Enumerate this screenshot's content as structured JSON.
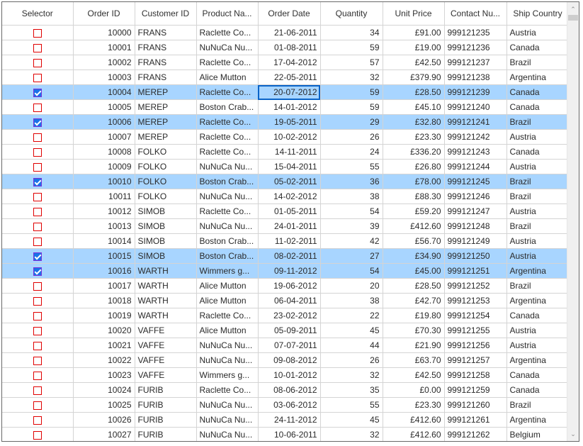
{
  "columns": [
    "Selector",
    "Order ID",
    "Customer ID",
    "Product Na...",
    "Order Date",
    "Quantity",
    "Unit Price",
    "Contact Nu...",
    "Ship Country"
  ],
  "rows": [
    {
      "checked": false,
      "order_id": "10000",
      "customer_id": "FRANS",
      "product": "Raclette Co...",
      "date": "21-06-2011",
      "qty": "34",
      "price": "£91.00",
      "contact": "999121235",
      "country": "Austria"
    },
    {
      "checked": false,
      "order_id": "10001",
      "customer_id": "FRANS",
      "product": "NuNuCa Nu...",
      "date": "01-08-2011",
      "qty": "59",
      "price": "£19.00",
      "contact": "999121236",
      "country": "Canada"
    },
    {
      "checked": false,
      "order_id": "10002",
      "customer_id": "FRANS",
      "product": "Raclette Co...",
      "date": "17-04-2012",
      "qty": "57",
      "price": "£42.50",
      "contact": "999121237",
      "country": "Brazil"
    },
    {
      "checked": false,
      "order_id": "10003",
      "customer_id": "FRANS",
      "product": "Alice Mutton",
      "date": "22-05-2011",
      "qty": "32",
      "price": "£379.90",
      "contact": "999121238",
      "country": "Argentina"
    },
    {
      "checked": true,
      "order_id": "10004",
      "customer_id": "MEREP",
      "product": "Raclette Co...",
      "date": "20-07-2012",
      "qty": "59",
      "price": "£28.50",
      "contact": "999121239",
      "country": "Canada",
      "focus": true
    },
    {
      "checked": false,
      "order_id": "10005",
      "customer_id": "MEREP",
      "product": "Boston Crab...",
      "date": "14-01-2012",
      "qty": "59",
      "price": "£45.10",
      "contact": "999121240",
      "country": "Canada"
    },
    {
      "checked": true,
      "order_id": "10006",
      "customer_id": "MEREP",
      "product": "Raclette Co...",
      "date": "19-05-2011",
      "qty": "29",
      "price": "£32.80",
      "contact": "999121241",
      "country": "Brazil"
    },
    {
      "checked": false,
      "order_id": "10007",
      "customer_id": "MEREP",
      "product": "Raclette Co...",
      "date": "10-02-2012",
      "qty": "26",
      "price": "£23.30",
      "contact": "999121242",
      "country": "Austria"
    },
    {
      "checked": false,
      "order_id": "10008",
      "customer_id": "FOLKO",
      "product": "Raclette Co...",
      "date": "14-11-2011",
      "qty": "24",
      "price": "£336.20",
      "contact": "999121243",
      "country": "Canada"
    },
    {
      "checked": false,
      "order_id": "10009",
      "customer_id": "FOLKO",
      "product": "NuNuCa Nu...",
      "date": "15-04-2011",
      "qty": "55",
      "price": "£26.80",
      "contact": "999121244",
      "country": "Austria"
    },
    {
      "checked": true,
      "order_id": "10010",
      "customer_id": "FOLKO",
      "product": "Boston Crab...",
      "date": "05-02-2011",
      "qty": "36",
      "price": "£78.00",
      "contact": "999121245",
      "country": "Brazil"
    },
    {
      "checked": false,
      "order_id": "10011",
      "customer_id": "FOLKO",
      "product": "NuNuCa Nu...",
      "date": "14-02-2012",
      "qty": "38",
      "price": "£88.30",
      "contact": "999121246",
      "country": "Brazil"
    },
    {
      "checked": false,
      "order_id": "10012",
      "customer_id": "SIMOB",
      "product": "Raclette Co...",
      "date": "01-05-2011",
      "qty": "54",
      "price": "£59.20",
      "contact": "999121247",
      "country": "Austria"
    },
    {
      "checked": false,
      "order_id": "10013",
      "customer_id": "SIMOB",
      "product": "NuNuCa Nu...",
      "date": "24-01-2011",
      "qty": "39",
      "price": "£412.60",
      "contact": "999121248",
      "country": "Brazil"
    },
    {
      "checked": false,
      "order_id": "10014",
      "customer_id": "SIMOB",
      "product": "Boston Crab...",
      "date": "11-02-2011",
      "qty": "42",
      "price": "£56.70",
      "contact": "999121249",
      "country": "Austria"
    },
    {
      "checked": true,
      "order_id": "10015",
      "customer_id": "SIMOB",
      "product": "Boston Crab...",
      "date": "08-02-2011",
      "qty": "27",
      "price": "£34.90",
      "contact": "999121250",
      "country": "Austria"
    },
    {
      "checked": true,
      "order_id": "10016",
      "customer_id": "WARTH",
      "product": "Wimmers g...",
      "date": "09-11-2012",
      "qty": "54",
      "price": "£45.00",
      "contact": "999121251",
      "country": "Argentina"
    },
    {
      "checked": false,
      "order_id": "10017",
      "customer_id": "WARTH",
      "product": "Alice Mutton",
      "date": "19-06-2012",
      "qty": "20",
      "price": "£28.50",
      "contact": "999121252",
      "country": "Brazil"
    },
    {
      "checked": false,
      "order_id": "10018",
      "customer_id": "WARTH",
      "product": "Alice Mutton",
      "date": "06-04-2011",
      "qty": "38",
      "price": "£42.70",
      "contact": "999121253",
      "country": "Argentina"
    },
    {
      "checked": false,
      "order_id": "10019",
      "customer_id": "WARTH",
      "product": "Raclette Co...",
      "date": "23-02-2012",
      "qty": "22",
      "price": "£19.80",
      "contact": "999121254",
      "country": "Canada"
    },
    {
      "checked": false,
      "order_id": "10020",
      "customer_id": "VAFFE",
      "product": "Alice Mutton",
      "date": "05-09-2011",
      "qty": "45",
      "price": "£70.30",
      "contact": "999121255",
      "country": "Austria"
    },
    {
      "checked": false,
      "order_id": "10021",
      "customer_id": "VAFFE",
      "product": "NuNuCa Nu...",
      "date": "07-07-2011",
      "qty": "44",
      "price": "£21.90",
      "contact": "999121256",
      "country": "Austria"
    },
    {
      "checked": false,
      "order_id": "10022",
      "customer_id": "VAFFE",
      "product": "NuNuCa Nu...",
      "date": "09-08-2012",
      "qty": "26",
      "price": "£63.70",
      "contact": "999121257",
      "country": "Argentina"
    },
    {
      "checked": false,
      "order_id": "10023",
      "customer_id": "VAFFE",
      "product": "Wimmers g...",
      "date": "10-01-2012",
      "qty": "32",
      "price": "£42.50",
      "contact": "999121258",
      "country": "Canada"
    },
    {
      "checked": false,
      "order_id": "10024",
      "customer_id": "FURIB",
      "product": "Raclette Co...",
      "date": "08-06-2012",
      "qty": "35",
      "price": "£0.00",
      "contact": "999121259",
      "country": "Canada"
    },
    {
      "checked": false,
      "order_id": "10025",
      "customer_id": "FURIB",
      "product": "NuNuCa Nu...",
      "date": "03-06-2012",
      "qty": "55",
      "price": "£23.30",
      "contact": "999121260",
      "country": "Brazil"
    },
    {
      "checked": false,
      "order_id": "10026",
      "customer_id": "FURIB",
      "product": "NuNuCa Nu...",
      "date": "24-11-2012",
      "qty": "45",
      "price": "£412.60",
      "contact": "999121261",
      "country": "Argentina"
    },
    {
      "checked": false,
      "order_id": "10027",
      "customer_id": "FURIB",
      "product": "NuNuCa Nu...",
      "date": "10-06-2011",
      "qty": "32",
      "price": "£412.60",
      "contact": "999121262",
      "country": "Belgium"
    }
  ],
  "colors": {
    "selected_row": "#a8d5ff",
    "checkbox_border": "#e00000",
    "checkbox_checked": "#1a73e8",
    "focus_border": "#0a64c8"
  },
  "scrollbar": {
    "up_icon": "^",
    "down_icon": "v"
  }
}
